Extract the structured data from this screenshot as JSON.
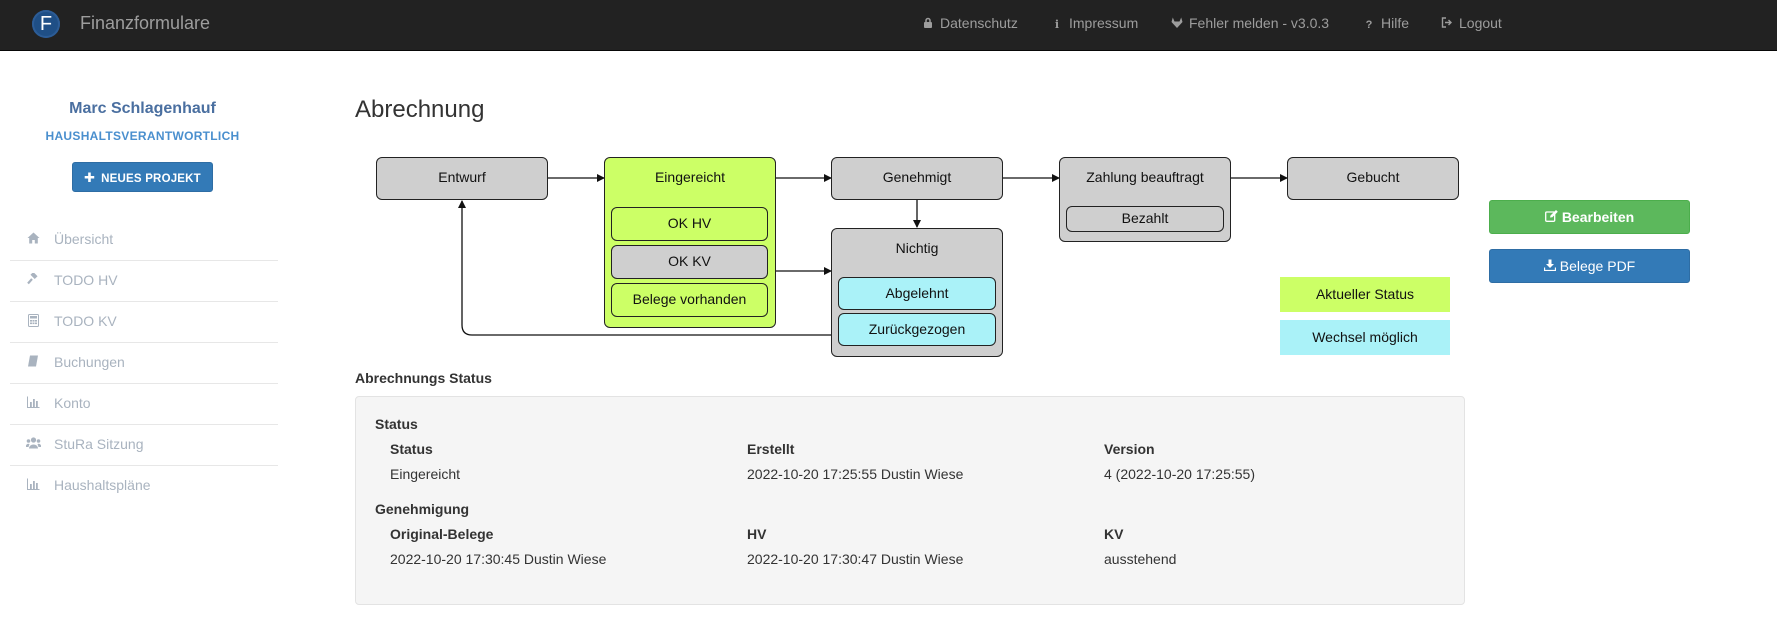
{
  "app": {
    "logo_letter": "F",
    "brand": "Finanzformulare"
  },
  "nav": [
    {
      "label": "Datenschutz",
      "icon": "lock-icon"
    },
    {
      "label": "Impressum",
      "icon": "info-icon"
    },
    {
      "label": "Fehler melden - v3.0.3",
      "icon": "gitlab-icon"
    },
    {
      "label": "Hilfe",
      "icon": "question-icon"
    },
    {
      "label": "Logout",
      "icon": "sign-out-icon"
    }
  ],
  "user": {
    "name": "Marc Schlagenhauf",
    "role": "HAUSHALTSVERANTWORTLICH"
  },
  "sidebar": {
    "new_project": "NEUES PROJEKT",
    "items": [
      {
        "label": "Übersicht",
        "icon": "home-icon"
      },
      {
        "label": "TODO HV",
        "icon": "gavel-icon"
      },
      {
        "label": "TODO KV",
        "icon": "calculator-icon"
      },
      {
        "label": "Buchungen",
        "icon": "book-icon"
      },
      {
        "label": "Konto",
        "icon": "bar-chart-icon"
      },
      {
        "label": "StuRa Sitzung",
        "icon": "users-icon"
      },
      {
        "label": "Haushaltspläne",
        "icon": "bar-chart-icon"
      }
    ]
  },
  "page": {
    "title": "Abrechnung"
  },
  "workflow": {
    "entwurf": "Entwurf",
    "eingereicht": "Eingereicht",
    "ok_hv": "OK HV",
    "ok_kv": "OK KV",
    "belege": "Belege vorhanden",
    "genehmigt": "Genehmigt",
    "nichtig": "Nichtig",
    "abgelehnt": "Abgelehnt",
    "zurueckgezogen": "Zurückgezogen",
    "zahlung": "Zahlung beauftragt",
    "bezahlt": "Bezahlt",
    "gebucht": "Gebucht",
    "colors": {
      "current": "#ccff66",
      "possible": "#aaf2f8",
      "default": "#cfcfcf"
    }
  },
  "legend": {
    "current": "Aktueller Status",
    "possible": "Wechsel möglich"
  },
  "actions": {
    "edit": "Bearbeiten",
    "pdf": "Belege PDF"
  },
  "status_section": {
    "heading": "Abrechnungs Status",
    "status_group": {
      "title": "Status",
      "cols": [
        {
          "label": "Status",
          "value": "Eingereicht"
        },
        {
          "label": "Erstellt",
          "value": "2022-10-20 17:25:55 Dustin Wiese"
        },
        {
          "label": "Version",
          "value": "4 (2022-10-20 17:25:55)"
        }
      ]
    },
    "approval_group": {
      "title": "Genehmigung",
      "cols": [
        {
          "label": "Original-Belege",
          "value": "2022-10-20 17:30:45 Dustin Wiese"
        },
        {
          "label": "HV",
          "value": "2022-10-20 17:30:47 Dustin Wiese"
        },
        {
          "label": "KV",
          "value": "ausstehend"
        }
      ]
    }
  }
}
